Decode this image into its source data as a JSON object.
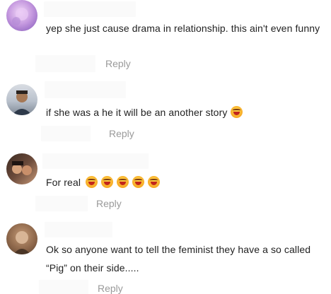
{
  "comments": [
    {
      "text": "yep she just cause drama in relationship. this ain't even funny",
      "reply_label": "Reply",
      "emojis": []
    },
    {
      "text": "if she was a he it will be an another story",
      "reply_label": "Reply",
      "emojis": [
        "laughing-tears-emoji"
      ]
    },
    {
      "text": "For real",
      "reply_label": "Reply",
      "emojis": [
        "laughing-tears-emoji",
        "laughing-tears-emoji",
        "laughing-tears-emoji",
        "laughing-tears-emoji",
        "laughing-tears-emoji"
      ]
    },
    {
      "text": "Ok so anyone want to tell the feminist they have a so called “Pig” on their side.....",
      "reply_label": "Reply",
      "emojis": []
    }
  ],
  "colors": {
    "text": "#222222",
    "reply": "#9a9a9a",
    "emoji": "#f6a623"
  }
}
